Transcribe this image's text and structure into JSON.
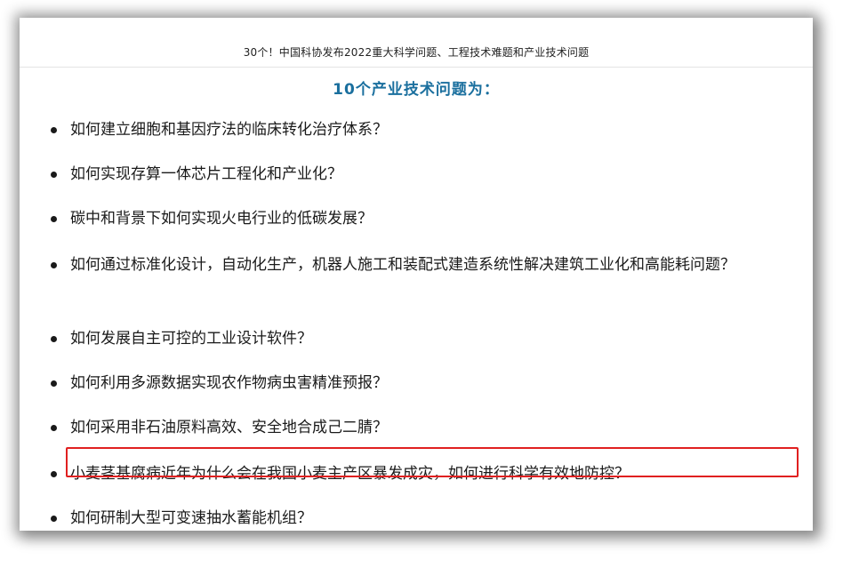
{
  "header": {
    "title": "30个！中国科协发布2022重大科学问题、工程技术难题和产业技术问题"
  },
  "section": {
    "heading": "10个产业技术问题为："
  },
  "items": [
    {
      "text": "如何建立细胞和基因疗法的临床转化治疗体系？"
    },
    {
      "text": "如何实现存算一体芯片工程化和产业化？"
    },
    {
      "text": "碳中和背景下如何实现火电行业的低碳发展？"
    },
    {
      "text": "如何通过标准化设计，自动化生产，机器人施工和装配式建造系统性解决建筑工业化和高能耗问题？"
    },
    {
      "text": "如何发展自主可控的工业设计软件？"
    },
    {
      "text": "如何利用多源数据实现农作物病虫害精准预报？"
    },
    {
      "text": "如何采用非石油原料高效、安全地合成己二腈？"
    },
    {
      "text": "小麦茎基腐病近年为什么会在我国小麦主产区暴发成灾，如何进行科学有效地防控？"
    },
    {
      "text": "如何研制大型可变速抽水蓄能机组？"
    }
  ],
  "colors": {
    "heading": "#1a6f9e",
    "highlight_border": "#e02020",
    "text": "#1a1a1a"
  }
}
